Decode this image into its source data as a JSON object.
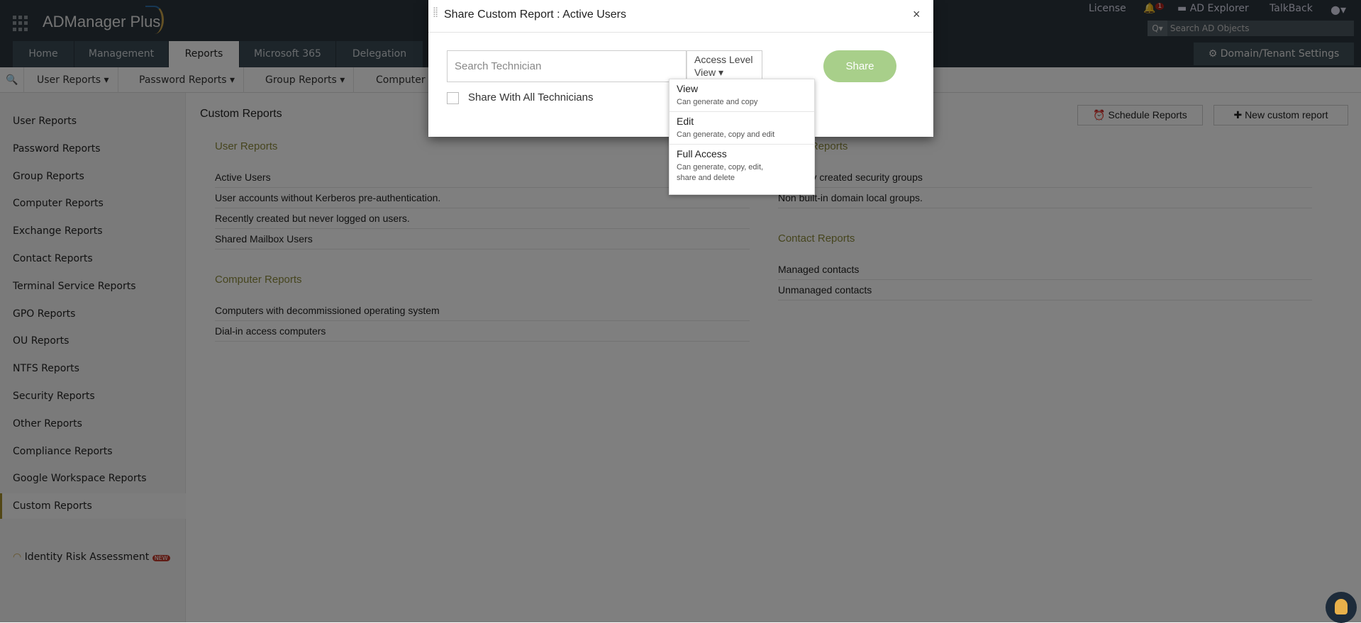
{
  "app": {
    "name": "ADManager Plus"
  },
  "topbar": {
    "license": "License",
    "notifications": "1",
    "ad_explorer": "AD Explorer",
    "talkback": "TalkBack",
    "search_placeholder": "Search AD Objects",
    "domain_settings": "Domain/Tenant Settings"
  },
  "tabs": [
    {
      "label": "Home"
    },
    {
      "label": "Management"
    },
    {
      "label": "Reports"
    },
    {
      "label": "Microsoft 365"
    },
    {
      "label": "Delegation"
    }
  ],
  "subnav": [
    {
      "label": "User Reports"
    },
    {
      "label": "Password Reports"
    },
    {
      "label": "Group Reports"
    },
    {
      "label": "Computer"
    }
  ],
  "sidebar": {
    "items": [
      {
        "label": "User Reports"
      },
      {
        "label": "Password Reports"
      },
      {
        "label": "Group Reports"
      },
      {
        "label": "Computer Reports"
      },
      {
        "label": "Exchange Reports"
      },
      {
        "label": "Contact Reports"
      },
      {
        "label": "Terminal Service Reports"
      },
      {
        "label": "GPO Reports"
      },
      {
        "label": "OU Reports"
      },
      {
        "label": "NTFS Reports"
      },
      {
        "label": "Security Reports"
      },
      {
        "label": "Other Reports"
      },
      {
        "label": "Compliance Reports"
      },
      {
        "label": "Google Workspace Reports"
      },
      {
        "label": "Custom Reports"
      }
    ],
    "identity_risk": "Identity Risk Assessment",
    "new_badge": "NEW"
  },
  "main": {
    "title": "Custom Reports",
    "schedule": "Schedule Reports",
    "new_report": "New custom report",
    "sections": [
      {
        "title": "User Reports",
        "rows": [
          "Active Users",
          "User accounts without Kerberos pre-authentication.",
          "Recently created but never logged on users.",
          "Shared Mailbox Users"
        ]
      },
      {
        "title": "Computer Reports",
        "rows": [
          "Computers with decommissioned operating system",
          "Dial-in access computers"
        ]
      },
      {
        "title": "Group Reports",
        "rows": [
          "Recently created security groups",
          "Non built-in domain local groups."
        ]
      },
      {
        "title": "Contact Reports",
        "rows": [
          "Managed contacts",
          "Unmanaged contacts"
        ]
      }
    ]
  },
  "dialog": {
    "title": "Share Custom Report : Active Users",
    "search_placeholder": "Search Technician",
    "access_label": "Access Level",
    "access_value": "View",
    "share": "Share",
    "share_all": "Share With All Technicians",
    "options": [
      {
        "title": "View",
        "desc": "Can generate and copy"
      },
      {
        "title": "Edit",
        "desc": "Can generate, copy and edit"
      },
      {
        "title": "Full Access",
        "desc": "Can generate, copy, edit, share and delete"
      }
    ]
  }
}
